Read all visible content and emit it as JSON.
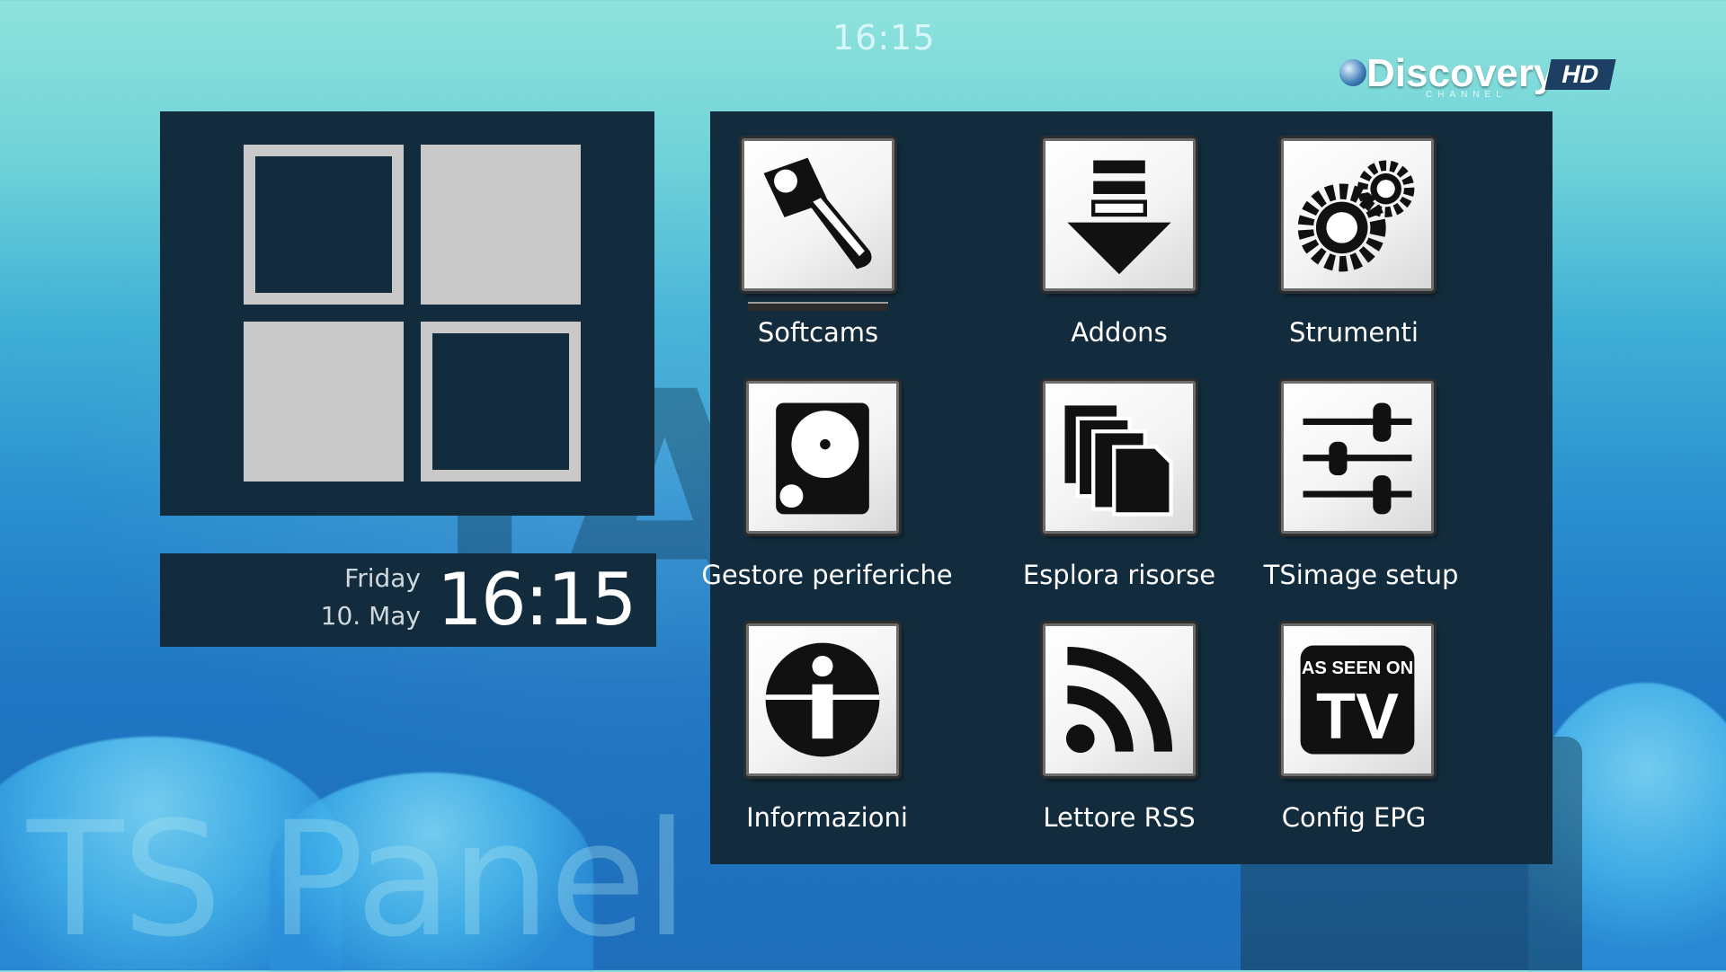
{
  "top_clock": "16:15",
  "channel_logo": {
    "name": "Discovery",
    "hd": "HD",
    "sub": "CHANNEL"
  },
  "logo_tiles": [
    "outline",
    "solid",
    "solid",
    "outline"
  ],
  "clock_widget": {
    "day": "Friday",
    "date": "10. May",
    "time": "16:15"
  },
  "menu": {
    "selected_index": 0,
    "items": [
      {
        "label": "Softcams",
        "icon": "key-icon"
      },
      {
        "label": "Addons",
        "icon": "download-icon"
      },
      {
        "label": "Strumenti",
        "icon": "gears-icon"
      },
      {
        "label": "Gestore periferiche",
        "icon": "hard-drive-icon"
      },
      {
        "label": "Esplora risorse",
        "icon": "files-icon"
      },
      {
        "label": "TSimage setup",
        "icon": "sliders-icon"
      },
      {
        "label": "Informazioni",
        "icon": "info-icon"
      },
      {
        "label": "Lettore RSS",
        "icon": "rss-icon"
      },
      {
        "label": "Config EPG",
        "icon": "as-seen-on-tv-icon",
        "icon_text": "AS SEEN ON",
        "icon_text_big": "TV"
      }
    ]
  },
  "panel_title": "TS Panel",
  "colors": {
    "panel": "#132c3d",
    "tile": "#c9c9c9",
    "text": "#ffffff"
  }
}
